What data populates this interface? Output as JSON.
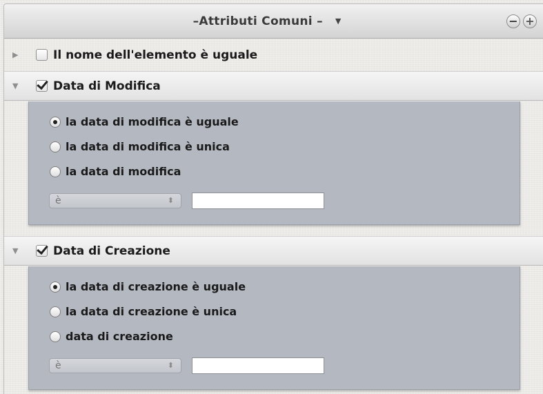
{
  "header": {
    "title": "–Attributi Comuni –",
    "dropdown_glyph": "▼",
    "remove_glyph": "−",
    "add_glyph": "+"
  },
  "rows": [
    {
      "disclosure": "▶",
      "label": "Il nome dell'elemento è uguale",
      "checked": false,
      "expanded": false
    },
    {
      "disclosure": "▼",
      "label": "Data di Modifica",
      "checked": true,
      "expanded": true
    },
    {
      "disclosure": "▼",
      "label": "Data di Creazione",
      "checked": true,
      "expanded": true
    }
  ],
  "modifica": {
    "options": [
      {
        "label": "la data di modifica è uguale",
        "selected": true
      },
      {
        "label": "la data di modifica è unica",
        "selected": false
      },
      {
        "label": "la data di modifica",
        "selected": false
      }
    ],
    "select_value": "è",
    "select_arrows": "⬍",
    "text_value": ""
  },
  "creazione": {
    "options": [
      {
        "label": "la data di creazione è uguale",
        "selected": true
      },
      {
        "label": "la data di creazione è unica",
        "selected": false
      },
      {
        "label": "data di creazione",
        "selected": false
      }
    ],
    "select_value": "è",
    "select_arrows": "⬍",
    "text_value": ""
  }
}
